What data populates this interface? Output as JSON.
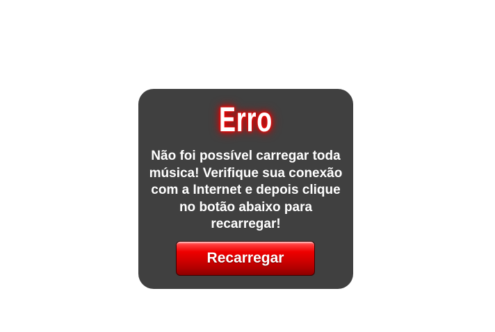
{
  "dialog": {
    "title": "Erro",
    "message": "Não foi possível carregar toda música! Verifique sua conexão com a Internet e depois clique no botão abaixo para recarregar!",
    "button_label": "Recarregar"
  },
  "colors": {
    "dialog_background": "#404040",
    "title_glow": "#ff0000",
    "button": "#d20000",
    "text": "#ffffff"
  }
}
